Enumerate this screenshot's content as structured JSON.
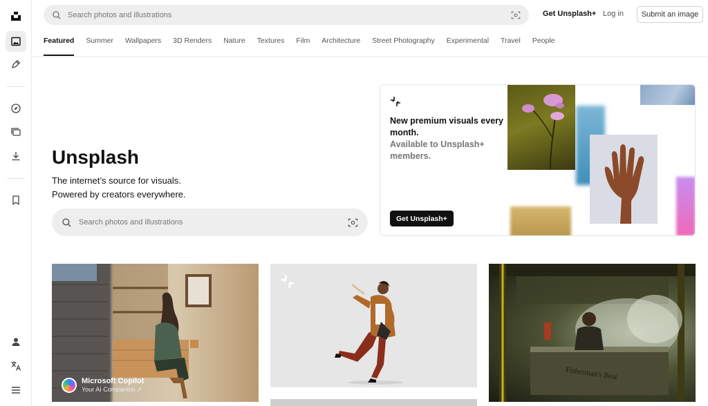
{
  "header": {
    "search_placeholder": "Search photos and illustrations",
    "get_plus": "Get Unsplash+",
    "login": "Log in",
    "submit": "Submit an image"
  },
  "topics": [
    "Featured",
    "Summer",
    "Wallpapers",
    "3D Renders",
    "Nature",
    "Textures",
    "Film",
    "Architecture",
    "Street Photography",
    "Experimental",
    "Travel",
    "People"
  ],
  "active_topic_index": 0,
  "hero": {
    "title": "Unsplash",
    "subtitle_line1": "The internet’s source for visuals.",
    "subtitle_line2": "Powered by creators everywhere.",
    "search_placeholder": "Search photos and illustrations"
  },
  "promo": {
    "headline": "New premium visuals every month.",
    "subline": "Available to Unsplash+ members.",
    "cta": "Get Unsplash+"
  },
  "photos": {
    "sponsor_name": "Microsoft Copilot",
    "sponsor_tagline": "Your AI Companion ↗"
  },
  "colors": {
    "accent": "#111111",
    "search_bg": "#eeeeee",
    "muted_text": "#767676"
  }
}
